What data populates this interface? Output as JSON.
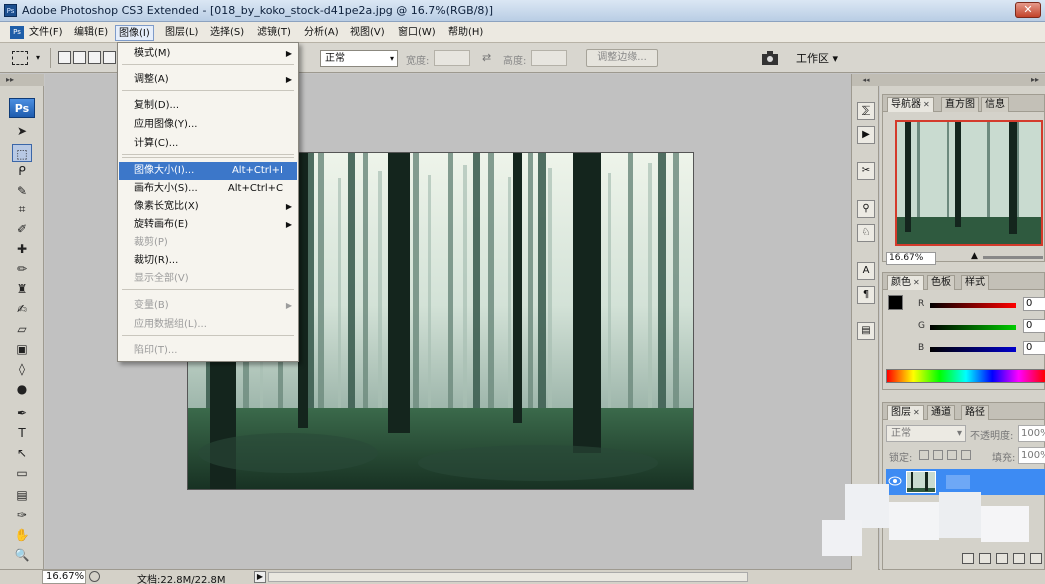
{
  "window": {
    "title": "Adobe Photoshop CS3 Extended - [018_by_koko_stock-d41pe2a.jpg @ 16.7%(RGB/8)]",
    "close_glyph": "✕"
  },
  "menubar": {
    "app_icon": "Ps",
    "items": [
      "文件(F)",
      "编辑(E)",
      "图像(I)",
      "图层(L)",
      "选择(S)",
      "滤镜(T)",
      "分析(A)",
      "视图(V)",
      "窗口(W)",
      "帮助(H)"
    ],
    "active_index": 2
  },
  "options": {
    "style_value": "正常",
    "width_label": "宽度:",
    "height_label": "高度:",
    "refine_edge": "调整边缘...",
    "workspace": "工作区 ▾",
    "swap_glyph": "⇄"
  },
  "image_menu": {
    "items": [
      {
        "label": "模式(M)",
        "shortcut": "",
        "submenu": true,
        "disabled": false,
        "highlighted": false
      },
      {
        "label": "调整(A)",
        "shortcut": "",
        "submenu": true,
        "disabled": false,
        "highlighted": false
      },
      {
        "label": "复制(D)...",
        "shortcut": "",
        "submenu": false,
        "disabled": false,
        "highlighted": false
      },
      {
        "label": "应用图像(Y)...",
        "shortcut": "",
        "submenu": false,
        "disabled": false,
        "highlighted": false
      },
      {
        "label": "计算(C)...",
        "shortcut": "",
        "submenu": false,
        "disabled": false,
        "highlighted": false
      },
      {
        "label": "图像大小(I)...",
        "shortcut": "Alt+Ctrl+I",
        "submenu": false,
        "disabled": false,
        "highlighted": true
      },
      {
        "label": "画布大小(S)...",
        "shortcut": "Alt+Ctrl+C",
        "submenu": false,
        "disabled": false,
        "highlighted": false
      },
      {
        "label": "像素长宽比(X)",
        "shortcut": "",
        "submenu": true,
        "disabled": false,
        "highlighted": false
      },
      {
        "label": "旋转画布(E)",
        "shortcut": "",
        "submenu": true,
        "disabled": false,
        "highlighted": false
      },
      {
        "label": "裁剪(P)",
        "shortcut": "",
        "submenu": false,
        "disabled": true,
        "highlighted": false
      },
      {
        "label": "裁切(R)...",
        "shortcut": "",
        "submenu": false,
        "disabled": false,
        "highlighted": false
      },
      {
        "label": "显示全部(V)",
        "shortcut": "",
        "submenu": false,
        "disabled": true,
        "highlighted": false
      },
      {
        "label": "变量(B)",
        "shortcut": "",
        "submenu": true,
        "disabled": true,
        "highlighted": false
      },
      {
        "label": "应用数据组(L)...",
        "shortcut": "",
        "submenu": false,
        "disabled": true,
        "highlighted": false
      },
      {
        "label": "陷印(T)...",
        "shortcut": "",
        "submenu": false,
        "disabled": true,
        "highlighted": false
      }
    ],
    "submenu_glyph": "▶"
  },
  "tools": {
    "logo": "Ps",
    "grip": "▸▸",
    "items": [
      {
        "name": "move-tool-icon",
        "glyph": "➤"
      },
      {
        "name": "marquee-tool-icon",
        "glyph": "⬚"
      },
      {
        "name": "lasso-tool-icon",
        "glyph": "ᑭ"
      },
      {
        "name": "magic-wand-tool-icon",
        "glyph": "✎"
      },
      {
        "name": "crop-tool-icon",
        "glyph": "⌗"
      },
      {
        "name": "slice-tool-icon",
        "glyph": "✐"
      },
      {
        "name": "healing-brush-tool-icon",
        "glyph": "✚"
      },
      {
        "name": "brush-tool-icon",
        "glyph": "✏"
      },
      {
        "name": "clone-stamp-tool-icon",
        "glyph": "♜"
      },
      {
        "name": "history-brush-tool-icon",
        "glyph": "✍"
      },
      {
        "name": "eraser-tool-icon",
        "glyph": "▱"
      },
      {
        "name": "gradient-tool-icon",
        "glyph": "▣"
      },
      {
        "name": "blur-tool-icon",
        "glyph": "◊"
      },
      {
        "name": "dodge-tool-icon",
        "glyph": "●"
      },
      {
        "name": "pen-tool-icon",
        "glyph": "✒"
      },
      {
        "name": "type-tool-icon",
        "glyph": "T"
      },
      {
        "name": "path-selection-tool-icon",
        "glyph": "↖"
      },
      {
        "name": "rectangle-tool-icon",
        "glyph": "▭"
      },
      {
        "name": "notes-tool-icon",
        "glyph": "▤"
      },
      {
        "name": "eyedropper-tool-icon",
        "glyph": "✑"
      },
      {
        "name": "hand-tool-icon",
        "glyph": "✋"
      },
      {
        "name": "zoom-tool-icon",
        "glyph": "🔍"
      }
    ]
  },
  "navigator": {
    "tabs": [
      "导航器",
      "直方图",
      "信息"
    ],
    "zoom": "16.67%"
  },
  "color_panel": {
    "tabs": [
      "颜色",
      "色板",
      "样式"
    ],
    "channels": [
      {
        "label": "R",
        "value": "0"
      },
      {
        "label": "G",
        "value": "0"
      },
      {
        "label": "B",
        "value": "0"
      }
    ]
  },
  "layers_panel": {
    "tabs": [
      "图层",
      "通道",
      "路径"
    ],
    "blend_mode": "正常",
    "opacity_label": "不透明度:",
    "opacity_value": "100%",
    "lock_label": "锁定:",
    "fill_label": "填充:",
    "fill_value": "100%"
  },
  "status": {
    "zoom": "16.67%",
    "doc_info": "文档:22.8M/22.8M",
    "arrow_glyph": "▶"
  },
  "colors": {
    "highlight": "#3c77c9",
    "layer_selected": "#3d8bf3"
  }
}
